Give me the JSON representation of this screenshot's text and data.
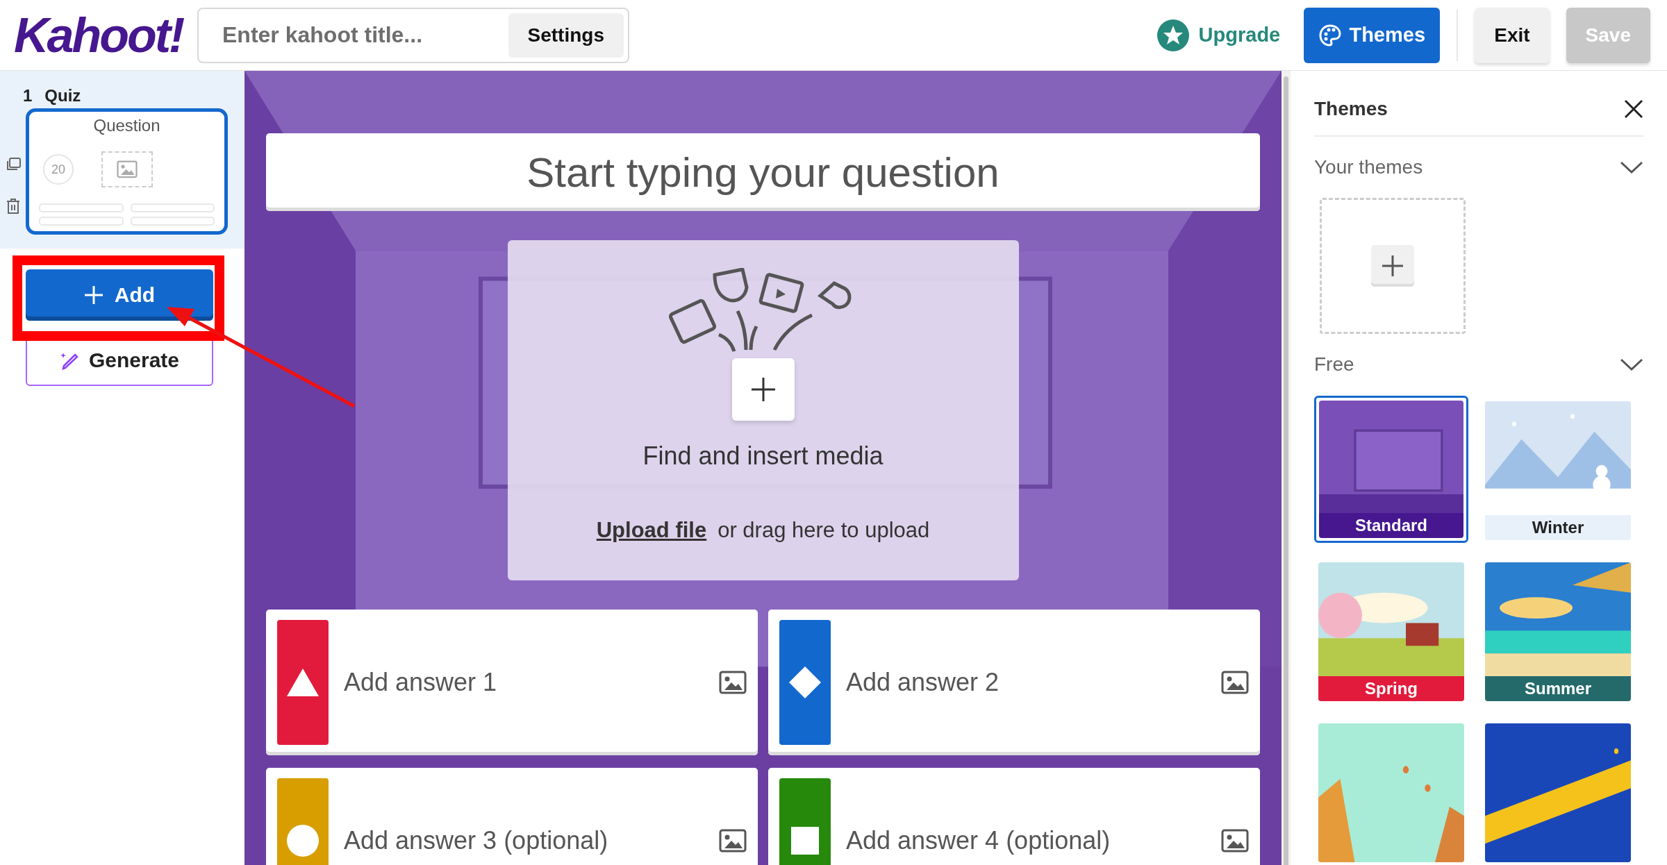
{
  "header": {
    "logo": "Kahoot!",
    "title_field": {
      "placeholder": "Enter kahoot title..."
    },
    "settings_button": "Settings",
    "upgrade_link": "Upgrade",
    "themes_button": "Themes",
    "exit_button": "Exit",
    "save_button": {
      "label": "Save",
      "disabled": true
    }
  },
  "sidebar": {
    "slides": [
      {
        "number": "1",
        "type": "Quiz",
        "title": "Question",
        "time": "20",
        "selected": true
      }
    ],
    "add_button": "Add",
    "generate_button": "Generate"
  },
  "editor": {
    "question": {
      "placeholder": "Start typing your question"
    },
    "media": {
      "title": "Find and insert media",
      "upload_link": "Upload file",
      "upload_hint": "or drag here to upload"
    },
    "answers": [
      {
        "placeholder": "Add answer 1",
        "kind": "triangle",
        "color": "#e21b3c"
      },
      {
        "placeholder": "Add answer 2",
        "kind": "diamond",
        "color": "#1368ce"
      },
      {
        "placeholder": "Add answer 3 (optional)",
        "kind": "circle",
        "color": "#d89e00"
      },
      {
        "placeholder": "Add answer 4 (optional)",
        "kind": "square",
        "color": "#26890c"
      }
    ]
  },
  "themes_panel": {
    "title": "Themes",
    "sections": [
      {
        "title": "Your themes",
        "expanded": true
      },
      {
        "title": "Free",
        "expanded": true
      }
    ],
    "themes": [
      {
        "label": "Standard",
        "selected": true,
        "color": "#46178f"
      },
      {
        "label": "Winter",
        "selected": false,
        "color": "#e8f0fa"
      },
      {
        "label": "Spring",
        "selected": false,
        "color": "#e21b3c"
      },
      {
        "label": "Summer",
        "selected": false,
        "color": "#256a6a"
      },
      {
        "selected": false
      },
      {
        "selected": false
      }
    ]
  }
}
